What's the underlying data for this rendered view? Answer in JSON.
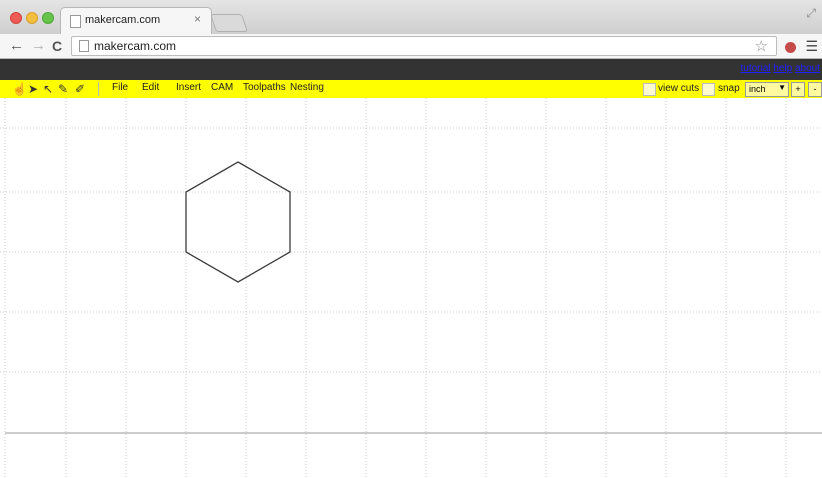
{
  "browser": {
    "tab_title": "makercam.com",
    "tab_close": "×",
    "url": "makercam.com",
    "icons": [
      "back-arrow-icon",
      "forward-arrow-icon",
      "reload-icon",
      "star-icon",
      "menu-icon"
    ]
  },
  "header": {
    "links": [
      "tutorial",
      "help",
      "about"
    ]
  },
  "toolbar": {
    "tools": [
      "hand-tool-icon",
      "pointer-tool-icon",
      "node-tool-icon",
      "pen-tool-icon",
      "bezier-tool-icon"
    ],
    "menus": [
      "File",
      "Edit",
      "Insert",
      "CAM",
      "Toolpaths",
      "Nesting"
    ],
    "view_cuts_label": "view cuts",
    "snap_label": "snap",
    "unit_value": "inch",
    "zoom_in_label": "+",
    "zoom_out_label": "-"
  },
  "canvas": {
    "shapes": [
      "hexagon"
    ],
    "grid": true,
    "colors": {
      "grid": "#cfcfcf",
      "shape": "#3c3c3c",
      "baseline": "#9a9a9a"
    }
  },
  "colors": {
    "toolbar_bg": "#ffff00",
    "darkbar_bg": "#333333",
    "link": "#2020ff"
  }
}
